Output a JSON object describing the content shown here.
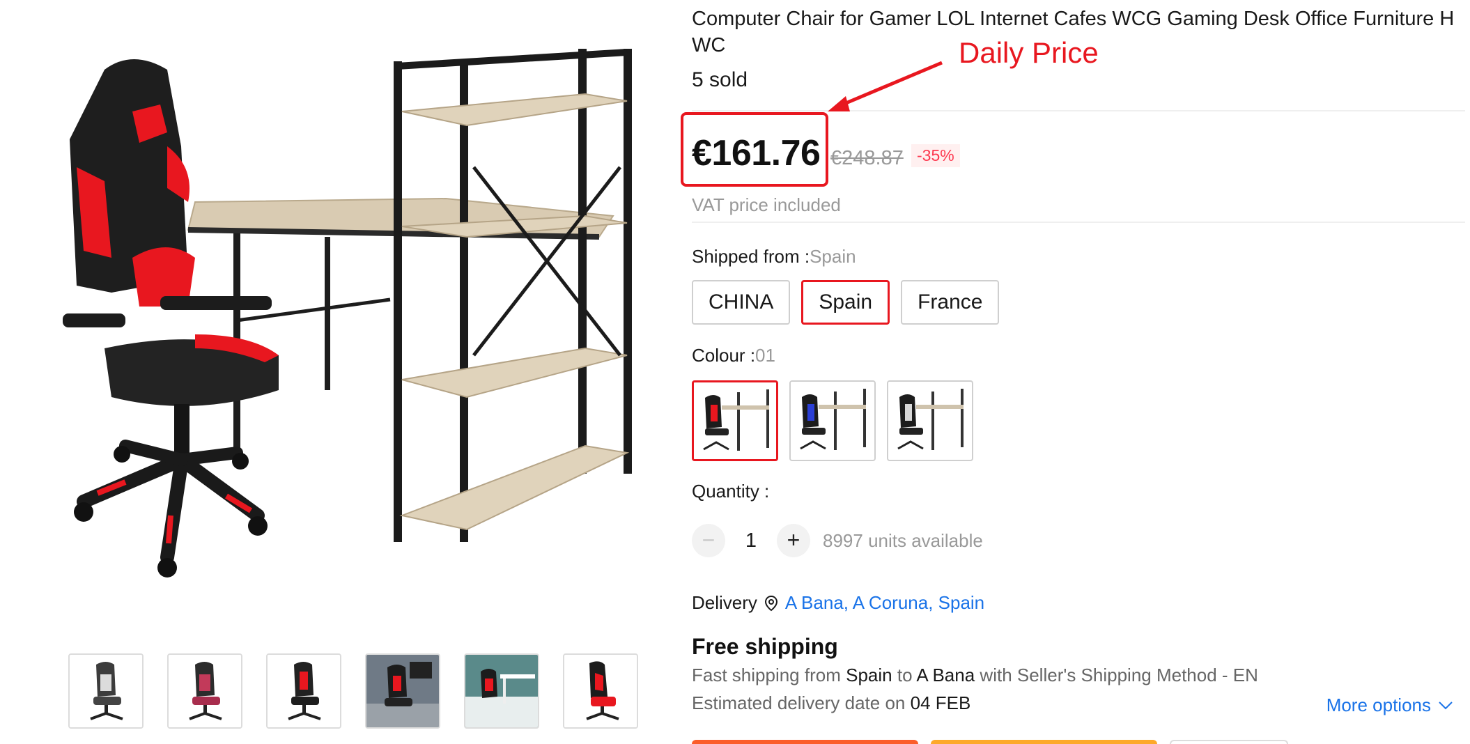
{
  "product": {
    "title": "Computer Chair for Gamer LOL Internet Cafes WCG Gaming Desk Office Furniture H WC",
    "sold": "5 sold",
    "price": "€161.76",
    "original_price": "€248.87",
    "discount": "-35%",
    "vat_note": "VAT price included"
  },
  "annotation": {
    "label": "Daily Price",
    "color": "#e8171f"
  },
  "shipping_from": {
    "label": "Shipped from :",
    "selected": "Spain",
    "options": [
      "CHINA",
      "Spain",
      "France"
    ]
  },
  "colour": {
    "label": "Colour :",
    "selected": "01",
    "options": [
      "red",
      "blue",
      "grey"
    ]
  },
  "quantity": {
    "label": "Quantity :",
    "value": "1",
    "decrement_icon": "minus-icon",
    "increment_icon": "plus-icon",
    "available": "8997 units available"
  },
  "delivery": {
    "label": "Delivery",
    "location": "A Bana, A Coruna, Spain"
  },
  "shipping": {
    "title": "Free shipping",
    "line1_prefix": "Fast shipping from",
    "line1_from": "Spain",
    "line1_to_word": "to",
    "line1_dest": "A Bana",
    "line1_suffix": "with Seller's Shipping Method - EN",
    "line2_prefix": "Estimated delivery date on",
    "line2_date": "04 FEB",
    "more_options": "More options"
  },
  "gallery": {
    "thumbnails": [
      "white-chair",
      "pink-chair",
      "red-chair",
      "room-chair",
      "desk-scene",
      "side-chair"
    ]
  },
  "colors": {
    "accent_red": "#e8171f",
    "link_blue": "#1a73e8",
    "muted_grey": "#999999",
    "buy_now": "#fb5d2a",
    "add_to_cart": "#fda92a"
  }
}
